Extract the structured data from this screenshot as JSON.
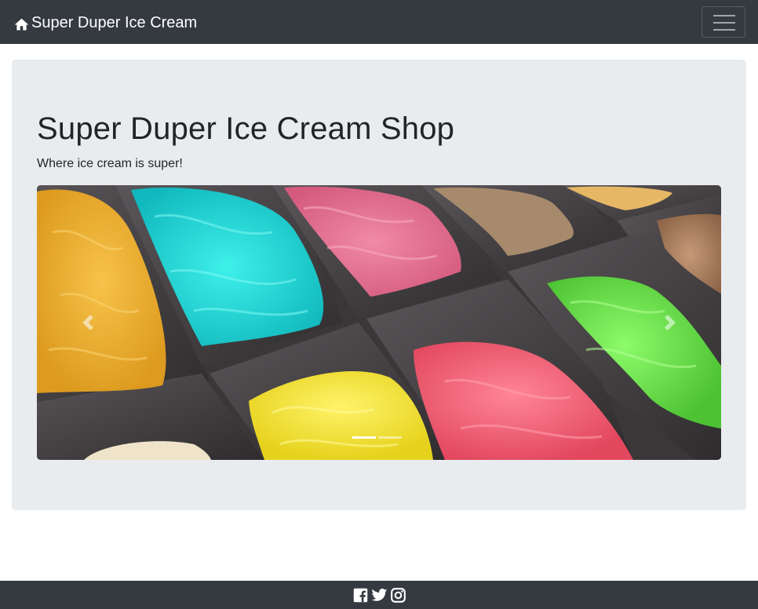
{
  "navbar": {
    "brand": "Super Duper Ice Cream",
    "brand_icon": "home-icon",
    "toggler_icon": "hamburger-menu-icon"
  },
  "jumbotron": {
    "heading": "Super Duper Ice Cream Shop",
    "lead": "Where ice cream is super!"
  },
  "carousel": {
    "slides_total": 2,
    "active_slide": 1,
    "prev_icon": "chevron-left-icon",
    "next_icon": "chevron-right-icon"
  },
  "footer": {
    "icons": [
      "facebook-icon",
      "twitter-icon",
      "instagram-icon"
    ]
  },
  "colors": {
    "navbar_bg": "#343a40",
    "jumbotron_bg": "#e9ecef",
    "text": "#212529"
  }
}
